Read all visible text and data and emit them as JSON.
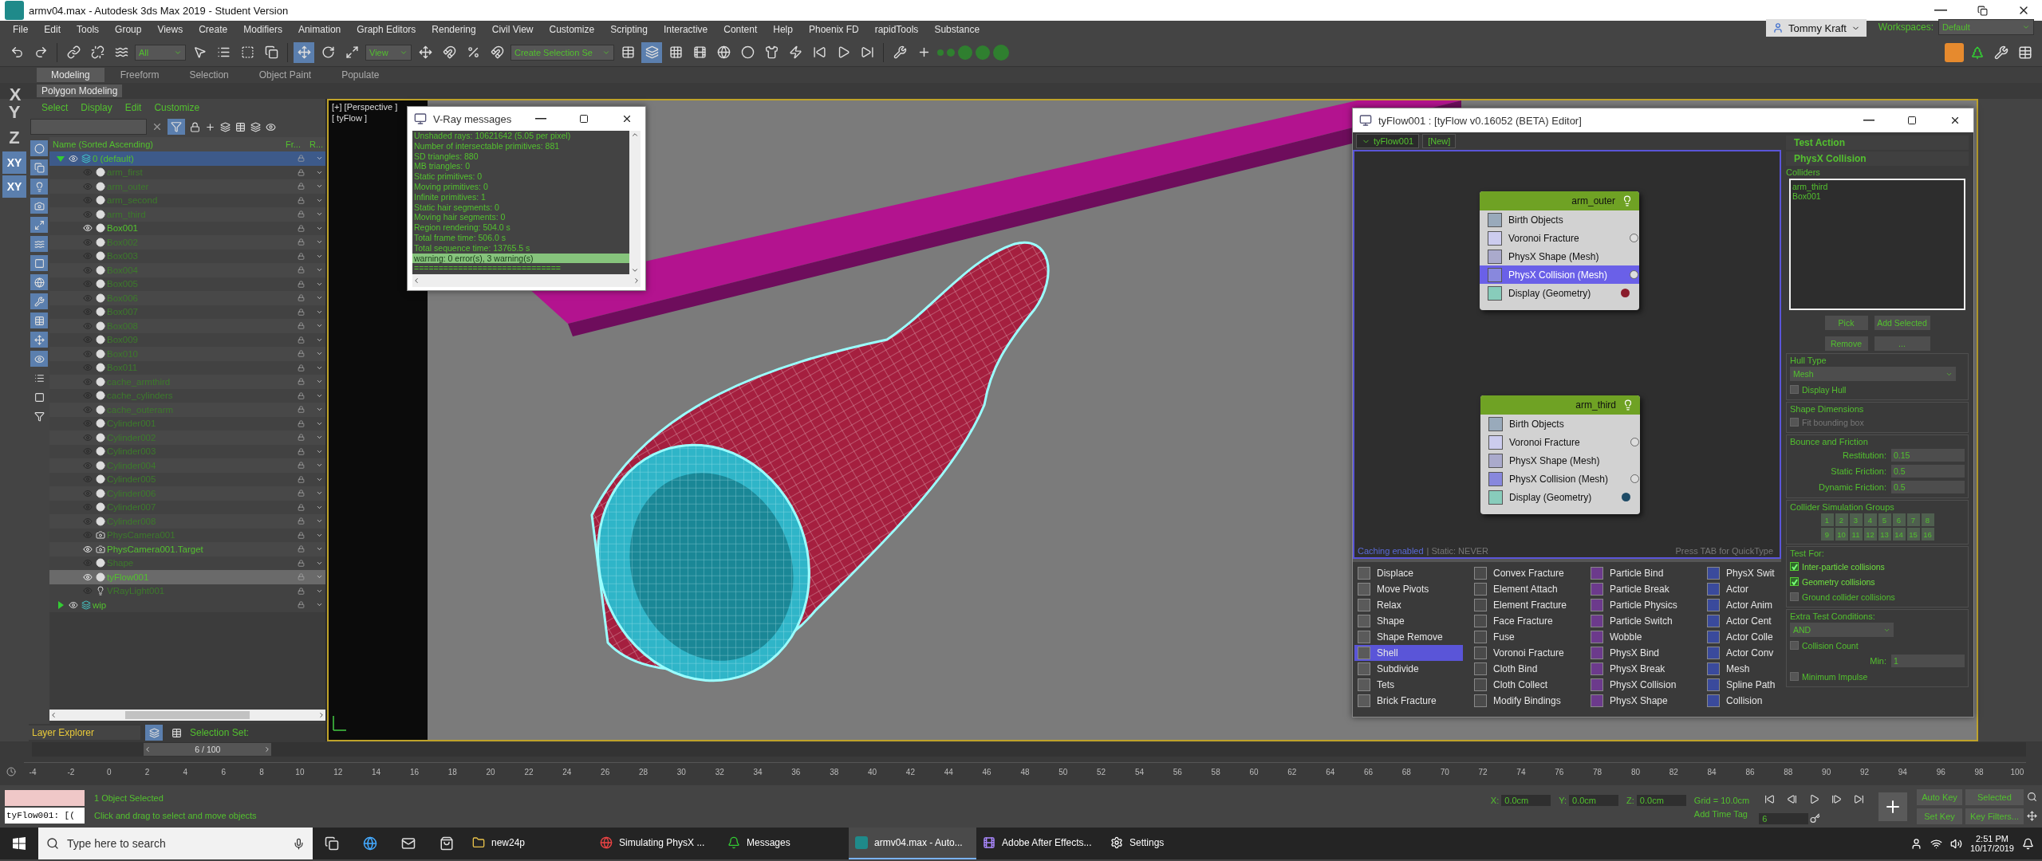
{
  "window": {
    "title": "armv04.max - Autodesk 3ds Max 2019 - Student Version"
  },
  "menu": [
    "File",
    "Edit",
    "Tools",
    "Group",
    "Views",
    "Create",
    "Modifiers",
    "Animation",
    "Graph Editors",
    "Rendering",
    "Civil View",
    "Customize",
    "Scripting",
    "Interactive",
    "Content",
    "Help",
    "Phoenix FD",
    "rapidTools",
    "Substance"
  ],
  "toolbar": {
    "selection_filter": "All",
    "ref_coord": "View",
    "named_selection": "Create Selection Se",
    "user": "Tommy Kraft",
    "workspaces_label": "Workspaces:",
    "workspace": "Default"
  },
  "ribbon_tabs": [
    {
      "label": "Modeling",
      "selected": true
    },
    {
      "label": "Freeform",
      "selected": false
    },
    {
      "label": "Selection",
      "selected": false
    },
    {
      "label": "Object Paint",
      "selected": false
    },
    {
      "label": "Populate",
      "selected": false
    }
  ],
  "ribbon_panel": "Polygon Modeling",
  "axis_letters": [
    "Y",
    "Z"
  ],
  "axis_buttons": [
    "XY",
    "XY"
  ],
  "ribbon_axis": "X",
  "scene_explorer": {
    "menu": [
      "Select",
      "Display",
      "Edit",
      "Customize"
    ],
    "columns": [
      "Name (Sorted Ascending)",
      "Fr...",
      "R..."
    ],
    "layers": [
      {
        "name": "0 (default)",
        "expanded": true,
        "selected": true,
        "children": [
          {
            "name": "arm_first",
            "kind": "object",
            "visible": false,
            "selected": false
          },
          {
            "name": "arm_outer",
            "kind": "object",
            "visible": false,
            "selected": false
          },
          {
            "name": "arm_second",
            "kind": "object",
            "visible": false,
            "selected": false
          },
          {
            "name": "arm_third",
            "kind": "object",
            "visible": false,
            "selected": false
          },
          {
            "name": "Box001",
            "kind": "object",
            "visible": true,
            "selected": false
          },
          {
            "name": "Box002",
            "kind": "object",
            "visible": false,
            "selected": false
          },
          {
            "name": "Box003",
            "kind": "object",
            "visible": false,
            "selected": false
          },
          {
            "name": "Box004",
            "kind": "object",
            "visible": false,
            "selected": false
          },
          {
            "name": "Box005",
            "kind": "object",
            "visible": false,
            "selected": false
          },
          {
            "name": "Box006",
            "kind": "object",
            "visible": false,
            "selected": false
          },
          {
            "name": "Box007",
            "kind": "object",
            "visible": false,
            "selected": false
          },
          {
            "name": "Box008",
            "kind": "object",
            "visible": false,
            "selected": false
          },
          {
            "name": "Box009",
            "kind": "object",
            "visible": false,
            "selected": false
          },
          {
            "name": "Box010",
            "kind": "object",
            "visible": false,
            "selected": false
          },
          {
            "name": "Box011",
            "kind": "object",
            "visible": false,
            "selected": false
          },
          {
            "name": "cache_armthird",
            "kind": "object",
            "visible": false,
            "selected": false
          },
          {
            "name": "cache_cylinders",
            "kind": "object",
            "visible": false,
            "selected": false
          },
          {
            "name": "cache_outerarm",
            "kind": "object",
            "visible": false,
            "selected": false
          },
          {
            "name": "Cylinder001",
            "kind": "object",
            "visible": false,
            "selected": false
          },
          {
            "name": "Cylinder002",
            "kind": "object",
            "visible": false,
            "selected": false
          },
          {
            "name": "Cylinder003",
            "kind": "object",
            "visible": false,
            "selected": false
          },
          {
            "name": "Cylinder004",
            "kind": "object",
            "visible": false,
            "selected": false
          },
          {
            "name": "Cylinder005",
            "kind": "object",
            "visible": false,
            "selected": false
          },
          {
            "name": "Cylinder006",
            "kind": "object",
            "visible": false,
            "selected": false
          },
          {
            "name": "Cylinder007",
            "kind": "object",
            "visible": false,
            "selected": false
          },
          {
            "name": "Cylinder008",
            "kind": "object",
            "visible": false,
            "selected": false
          },
          {
            "name": "PhysCamera001",
            "kind": "camera",
            "visible": false,
            "selected": false
          },
          {
            "name": "PhysCamera001.Target",
            "kind": "camera",
            "visible": true,
            "selected": false
          },
          {
            "name": "Shape",
            "kind": "object",
            "visible": false,
            "selected": false
          },
          {
            "name": "tyFlow001",
            "kind": "object",
            "visible": true,
            "selected": true
          },
          {
            "name": "VRayLight001",
            "kind": "light",
            "visible": false,
            "selected": false
          }
        ]
      },
      {
        "name": "wip",
        "expanded": false,
        "selected": false
      }
    ],
    "footer": "Layer Explorer",
    "selection_set": "Selection Set:"
  },
  "viewport": {
    "labels": [
      "[+] [Perspective ]",
      "[ tyFlow ]"
    ]
  },
  "vray": {
    "title": "V-Ray messages",
    "lines": [
      {
        "text": "Unshaded rays: 10621642 (5.05 per pixel)",
        "selected": false
      },
      {
        "text": "Number of intersectable primitives: 881",
        "selected": false
      },
      {
        "text": "SD triangles: 880",
        "selected": false
      },
      {
        "text": "MB triangles: 0",
        "selected": false
      },
      {
        "text": "Static primitives: 0",
        "selected": false
      },
      {
        "text": "Moving primitives: 0",
        "selected": false
      },
      {
        "text": "Infinite primitives: 1",
        "selected": false
      },
      {
        "text": "Static hair segments: 0",
        "selected": false
      },
      {
        "text": "Moving hair segments: 0",
        "selected": false
      },
      {
        "text": "Region rendering: 504.0 s",
        "selected": false
      },
      {
        "text": "Total frame time: 506.0 s",
        "selected": false
      },
      {
        "text": "Total sequence time: 13765.5 s",
        "selected": false
      },
      {
        "text": "warning: 0 error(s), 3 warning(s)",
        "selected": true
      },
      {
        "text": "==============================",
        "selected": false
      }
    ]
  },
  "tyflow": {
    "title": "tyFlow001 : [tyFlow v0.16052 (BETA) Editor]",
    "tabs": [
      {
        "label": "tyFlow001",
        "selected": true
      },
      {
        "label": "[New]",
        "selected": false
      }
    ],
    "events": [
      {
        "name": "arm_outer",
        "color": "#8a1c2c",
        "operators": [
          {
            "name": "Birth Objects",
            "selected": false,
            "output": false
          },
          {
            "name": "Voronoi Fracture",
            "selected": false,
            "output": true
          },
          {
            "name": "PhysX Shape (Mesh)",
            "selected": false,
            "output": false
          },
          {
            "name": "PhysX Collision (Mesh)",
            "selected": true,
            "output": true
          },
          {
            "name": "Display (Geometry)",
            "selected": false,
            "output": false
          }
        ]
      },
      {
        "name": "arm_third",
        "color": "#1e4b66",
        "operators": [
          {
            "name": "Birth Objects",
            "selected": false,
            "output": false
          },
          {
            "name": "Voronoi Fracture",
            "selected": false,
            "output": true
          },
          {
            "name": "PhysX Shape (Mesh)",
            "selected": false,
            "output": false
          },
          {
            "name": "PhysX Collision (Mesh)",
            "selected": false,
            "output": true
          },
          {
            "name": "Display (Geometry)",
            "selected": false,
            "output": false
          }
        ]
      }
    ],
    "status": {
      "caching": "Caching enabled",
      "static": "| Static: NEVER",
      "hint": "Press TAB for QuickType"
    },
    "palette": [
      {
        "name": "Displace",
        "selected": false
      },
      {
        "name": "Move Pivots",
        "selected": false
      },
      {
        "name": "Relax",
        "selected": false
      },
      {
        "name": "Shape",
        "selected": false
      },
      {
        "name": "Shape Remove",
        "selected": false
      },
      {
        "name": "Shell",
        "selected": true
      },
      {
        "name": "Subdivide",
        "selected": false
      },
      {
        "name": "Tets",
        "selected": false
      },
      {
        "name": "Brick Fracture",
        "selected": false
      },
      {
        "name": "Convex Fracture",
        "selected": false
      },
      {
        "name": "Element Attach",
        "selected": false
      },
      {
        "name": "Element Fracture",
        "selected": false
      },
      {
        "name": "Face Fracture",
        "selected": false
      },
      {
        "name": "Fuse",
        "selected": false
      },
      {
        "name": "Voronoi Fracture",
        "selected": false
      },
      {
        "name": "Cloth Bind",
        "selected": false
      },
      {
        "name": "Cloth Collect",
        "selected": false
      },
      {
        "name": "Modify Bindings",
        "selected": false
      },
      {
        "name": "Particle Bind",
        "selected": false
      },
      {
        "name": "Particle Break",
        "selected": false
      },
      {
        "name": "Particle Physics",
        "selected": false
      },
      {
        "name": "Particle Switch",
        "selected": false
      },
      {
        "name": "Wobble",
        "selected": false
      },
      {
        "name": "PhysX Bind",
        "selected": false
      },
      {
        "name": "PhysX Break",
        "selected": false
      },
      {
        "name": "PhysX Collision",
        "selected": false
      },
      {
        "name": "PhysX Shape",
        "selected": false
      },
      {
        "name": "PhysX Swit",
        "selected": false
      },
      {
        "name": "Actor",
        "selected": false
      },
      {
        "name": "Actor Anim",
        "selected": false
      },
      {
        "name": "Actor Cent",
        "selected": false
      },
      {
        "name": "Actor Colle",
        "selected": false
      },
      {
        "name": "Actor Conv",
        "selected": false
      },
      {
        "name": "Mesh",
        "selected": false
      },
      {
        "name": "Spline Path",
        "selected": false
      },
      {
        "name": "Collision",
        "selected": false
      }
    ],
    "panel": {
      "title": "Test Action",
      "rollout": "PhysX Collision",
      "colliders_label": "Colliders",
      "colliders": [
        "arm_third",
        "Box001"
      ],
      "buttons": [
        "Pick",
        "Add Selected",
        "Remove",
        "..."
      ],
      "groups": [
        {
          "title": "Hull Type",
          "items": [
            {
              "kind": "dropdown",
              "value": "Mesh"
            },
            {
              "kind": "checkbox",
              "label": "Display Hull",
              "checked": false,
              "disabled": false
            }
          ]
        },
        {
          "title": "Shape Dimensions",
          "items": [
            {
              "kind": "checkbox",
              "label": "Fit bounding box",
              "checked": false,
              "disabled": true
            }
          ]
        },
        {
          "title": "Bounce and Friction",
          "items": [
            {
              "kind": "spinner",
              "label": "Restitution:",
              "value": "0.15"
            },
            {
              "kind": "spinner",
              "label": "Static Friction:",
              "value": "0.5"
            },
            {
              "kind": "spinner",
              "label": "Dynamic Friction:",
              "value": "0.5"
            }
          ]
        },
        {
          "title": "Collider Simulation Groups",
          "items": [
            {
              "kind": "groups",
              "values": [
                "1",
                "2",
                "3",
                "4",
                "5",
                "6",
                "7",
                "8",
                "9",
                "10",
                "11",
                "12",
                "13",
                "14",
                "15",
                "16"
              ]
            }
          ]
        },
        {
          "title": "Test For:",
          "items": [
            {
              "kind": "checkbox",
              "label": "Inter-particle collisions",
              "checked": true,
              "disabled": false
            },
            {
              "kind": "checkbox",
              "label": "Geometry collisions",
              "checked": true,
              "disabled": false
            },
            {
              "kind": "checkbox",
              "label": "Ground collider collisions",
              "checked": false,
              "disabled": false
            }
          ]
        },
        {
          "title": "Extra Test Conditions:",
          "items": [
            {
              "kind": "dropdown",
              "value": "AND"
            },
            {
              "kind": "checkbox",
              "label": "Collision Count",
              "checked": false,
              "disabled": false
            },
            {
              "kind": "spinner",
              "label": "Min:",
              "value": "1"
            },
            {
              "kind": "checkbox",
              "label": "Minimum Impulse",
              "checked": false,
              "disabled": false
            }
          ]
        }
      ]
    }
  },
  "timeline": {
    "frame": "6 / 100",
    "level": 0.06,
    "ticks": [
      "-4",
      "-2",
      "0",
      "2",
      "4",
      "6",
      "8",
      "10",
      "12",
      "14",
      "16",
      "18",
      "20",
      "22",
      "24",
      "26",
      "28",
      "30",
      "32",
      "34",
      "36",
      "38",
      "40",
      "42",
      "44",
      "46",
      "48",
      "50",
      "52",
      "54",
      "56",
      "58",
      "60",
      "62",
      "64",
      "66",
      "68",
      "70",
      "72",
      "74",
      "76",
      "78",
      "80",
      "82",
      "84",
      "86",
      "88",
      "90",
      "92",
      "94",
      "96",
      "98",
      "100"
    ]
  },
  "status_bar": {
    "script": "tyFlow001: [(",
    "selection": "1 Object Selected",
    "prompt": "Click and drag to select and move objects",
    "coords": [
      {
        "axis": "X:",
        "value": "0.0cm"
      },
      {
        "axis": "Y:",
        "value": "0.0cm"
      },
      {
        "axis": "Z:",
        "value": "0.0cm"
      }
    ],
    "grid": "Grid = 10.0cm",
    "time_tag": "Add Time Tag",
    "auto_key": "Auto Key",
    "key_mode": "Selected",
    "set_key": "Set Key",
    "key_filters": "Key Filters...",
    "current_frame": "6"
  },
  "taskbar": {
    "search": "Type here to search",
    "apps": [
      {
        "label": "new24p",
        "selected": false
      },
      {
        "label": "Simulating PhysX ...",
        "selected": false
      },
      {
        "label": "Messages",
        "selected": false
      },
      {
        "label": "armv04.max - Auto...",
        "selected": true
      },
      {
        "label": "Adobe After Effects...",
        "selected": false
      },
      {
        "label": "Settings",
        "selected": false
      }
    ],
    "time": "2:51 PM",
    "date": "10/17/2019"
  }
}
